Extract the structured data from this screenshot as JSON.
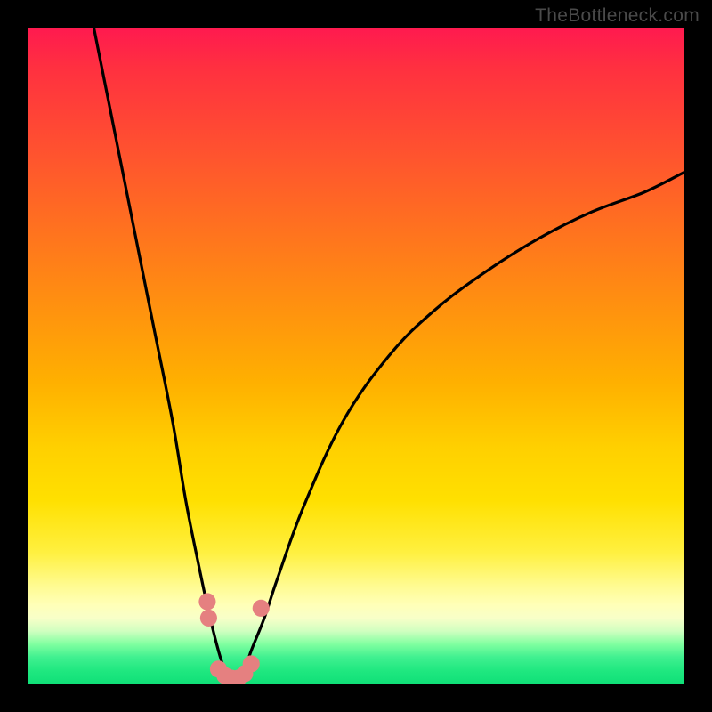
{
  "watermark": "TheBottleneck.com",
  "chart_data": {
    "type": "line",
    "title": "",
    "xlabel": "",
    "ylabel": "",
    "xlim": [
      0,
      100
    ],
    "ylim": [
      0,
      100
    ],
    "grid": false,
    "legend": false,
    "annotations": [],
    "background": {
      "type": "vertical_gradient",
      "stops": [
        {
          "pos": 0,
          "color": "#ff1a4f"
        },
        {
          "pos": 50,
          "color": "#ffb000"
        },
        {
          "pos": 85,
          "color": "#fffb90"
        },
        {
          "pos": 100,
          "color": "#10e078"
        }
      ]
    },
    "series": [
      {
        "name": "bottleneck_curve",
        "color": "#000000",
        "x": [
          10,
          13,
          16,
          19,
          22,
          24,
          26,
          27.5,
          29,
          30,
          31,
          32,
          33,
          34,
          36,
          38,
          42,
          48,
          55,
          62,
          70,
          78,
          86,
          94,
          100
        ],
        "y": [
          100,
          85,
          70,
          55,
          40,
          28,
          18,
          11,
          5,
          2,
          0.5,
          0.5,
          2,
          5,
          10,
          16,
          27,
          40,
          50,
          57,
          63,
          68,
          72,
          75,
          78
        ]
      }
    ],
    "markers": [
      {
        "x": 27.3,
        "y": 12.5,
        "color": "#e58080",
        "r": 1.3
      },
      {
        "x": 27.5,
        "y": 10.0,
        "color": "#e58080",
        "r": 1.3
      },
      {
        "x": 29.0,
        "y": 2.2,
        "color": "#e58080",
        "r": 1.3
      },
      {
        "x": 30.0,
        "y": 1.2,
        "color": "#e58080",
        "r": 1.3
      },
      {
        "x": 31.0,
        "y": 0.8,
        "color": "#e58080",
        "r": 1.3
      },
      {
        "x": 32.0,
        "y": 0.8,
        "color": "#e58080",
        "r": 1.3
      },
      {
        "x": 33.0,
        "y": 1.5,
        "color": "#e58080",
        "r": 1.3
      },
      {
        "x": 34.0,
        "y": 3.0,
        "color": "#e58080",
        "r": 1.3
      },
      {
        "x": 35.5,
        "y": 11.5,
        "color": "#e58080",
        "r": 1.3
      }
    ]
  }
}
